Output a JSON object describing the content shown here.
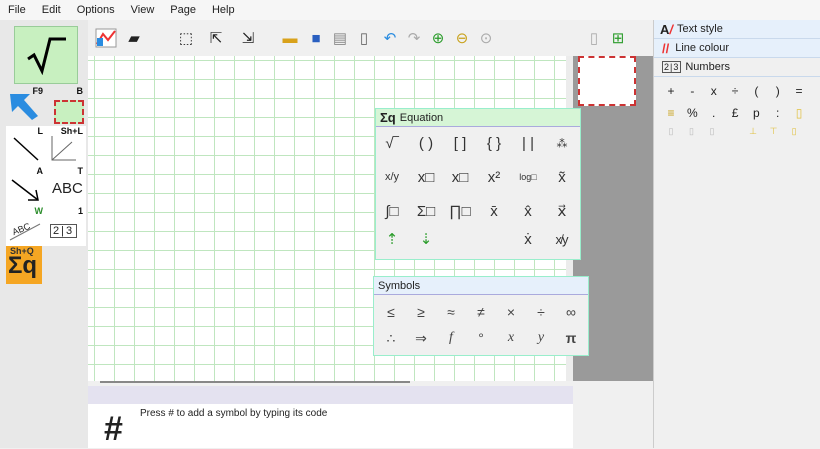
{
  "menu": [
    "File",
    "Edit",
    "Options",
    "View",
    "Page",
    "Help"
  ],
  "tools": {
    "f9_key": "F9",
    "b_key": "B",
    "l_key": "L",
    "shl_key": "Sh+L",
    "a_key": "A",
    "t_key": "T",
    "w_key": "W",
    "one_key": "1",
    "shq_key": "Sh+Q",
    "abc_label": "ABC",
    "abc_slant_label": "ABC",
    "numbers_label": "2|3",
    "eq_label": "Σq"
  },
  "right_panel": {
    "text_style": "Text style",
    "line_colour": "Line colour",
    "numbers": "Numbers",
    "numbers_icon": "2|3",
    "keys_row1": [
      "+",
      "-",
      "x",
      "÷",
      "(",
      ")",
      "="
    ],
    "keys_row2": [
      "%",
      ".",
      "£",
      "p",
      ":"
    ]
  },
  "equation_panel": {
    "title": "Equation",
    "title_icon": "Σq",
    "row1": [
      "√‾",
      "( )",
      "[ ]",
      "{ }",
      "| |",
      "⁂"
    ],
    "row2": [
      "x/y",
      "x□",
      "x□",
      "x²",
      "log□",
      "x̃"
    ],
    "row3": [
      "∫□",
      "Σ□",
      "∏□",
      "x̄",
      "x̂",
      "x⃗"
    ],
    "row4": [
      "⇡",
      "⇣",
      "",
      "ẋ",
      "x̸y"
    ]
  },
  "symbols_panel": {
    "title": "Symbols",
    "row1": [
      "≤",
      "≥",
      "≈",
      "≠",
      "×",
      "÷",
      "∞"
    ],
    "row2": [
      "∴",
      "⇒",
      "f",
      "°",
      "x",
      "y",
      "π"
    ]
  },
  "bottom_bar": {
    "hash": "#",
    "hint": "Press # to add a symbol by typing its code"
  },
  "colors": {
    "accent_green": "#c8f0c0",
    "panel_header": "#d6f5d6",
    "grid": "#bfe6bf",
    "selection_red": "#cc3333"
  }
}
